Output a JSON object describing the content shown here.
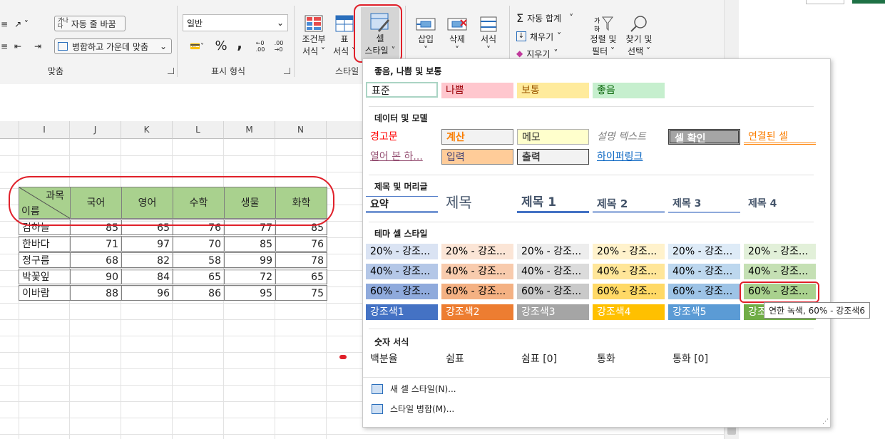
{
  "ribbon": {
    "wrap_text": "자동 줄 바꿈",
    "merge_center": "병합하고 가운데 맞춤",
    "align_group": "맞춤",
    "number_format": "일반",
    "number_group": "표시 형식",
    "percent": "%",
    "comma": ",",
    "conditional": "조건부",
    "conditional2": "서식",
    "as_table": "표",
    "as_table2": "서식",
    "cell_styles": "셀",
    "cell_styles2": "스타일",
    "styles_group": "스타일",
    "insert": "삽입",
    "delete": "삭제",
    "format": "서식",
    "autosum": "자동 합계",
    "fill": "채우기",
    "clear": "지우기",
    "sort_filter": "정렬 및",
    "sort_filter2": "필터",
    "find_select": "찾기 및",
    "find_select2": "선택"
  },
  "columns": [
    "I",
    "J",
    "K",
    "L",
    "M",
    "N"
  ],
  "table": {
    "diag_top": "과목",
    "diag_bottom": "이름",
    "headers": [
      "국어",
      "영어",
      "수학",
      "생물",
      "화학"
    ],
    "rows": [
      {
        "name": "김하늘",
        "values": [
          "85",
          "65",
          "76",
          "77",
          "85"
        ]
      },
      {
        "name": "한바다",
        "values": [
          "71",
          "97",
          "70",
          "85",
          "76"
        ]
      },
      {
        "name": "정구름",
        "values": [
          "68",
          "82",
          "58",
          "99",
          "78"
        ]
      },
      {
        "name": "박꽃잎",
        "values": [
          "90",
          "84",
          "65",
          "72",
          "65"
        ]
      },
      {
        "name": "이바람",
        "values": [
          "88",
          "96",
          "86",
          "95",
          "75"
        ]
      }
    ]
  },
  "dropdown": {
    "sections": {
      "good_bad": "좋음, 나쁨 및 보통",
      "data_model": "데이터 및 모델",
      "titles": "제목 및 머리글",
      "theme": "테마 셀 스타일",
      "number": "숫자 서식"
    },
    "good_bad": [
      "표준",
      "나쁨",
      "보통",
      "좋음"
    ],
    "data_model_row1": [
      "경고문",
      "계산",
      "메모",
      "설명 텍스트",
      "셀 확인",
      "연결된 셀"
    ],
    "data_model_row2": [
      "열어 본 하...",
      "입력",
      "출력",
      "하이퍼링크"
    ],
    "titles": [
      "요약",
      "제목",
      "제목 1",
      "제목 2",
      "제목 3",
      "제목 4"
    ],
    "theme_20": [
      "20% - 강조...",
      "20% - 강조...",
      "20% - 강조...",
      "20% - 강조...",
      "20% - 강조...",
      "20% - 강조..."
    ],
    "theme_40": [
      "40% - 강조...",
      "40% - 강조...",
      "40% - 강조...",
      "40% - 강조...",
      "40% - 강조...",
      "40% - 강조..."
    ],
    "theme_60": [
      "60% - 강조...",
      "60% - 강조...",
      "60% - 강조...",
      "60% - 강조...",
      "60% - 강조...",
      "60% - 강조..."
    ],
    "theme_accent": [
      "강조색1",
      "강조색2",
      "강조색3",
      "강조색4",
      "강조색5",
      "강조"
    ],
    "number": [
      "백분율",
      "쉼표",
      "쉼표 [0]",
      "통화",
      "통화 [0]"
    ],
    "new_style": "새 셀 스타일(N)...",
    "merge_styles": "스타일 병합(M)...",
    "tooltip": "연한 녹색, 60% - 강조색6"
  },
  "colors": {
    "accent_green": "#a9d18e",
    "annotation_red": "#e0202a"
  }
}
